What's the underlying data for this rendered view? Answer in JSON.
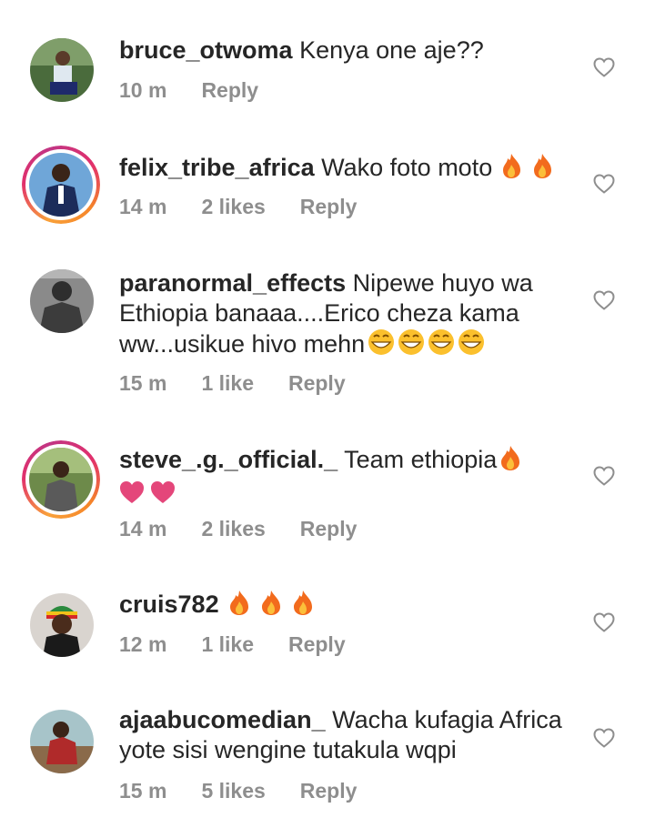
{
  "comments": [
    {
      "username": "bruce_otwoma",
      "text": "Kenya one aje??",
      "time": "10 m",
      "likes": "",
      "reply": "Reply",
      "emoji": ""
    },
    {
      "username": "felix_tribe_africa",
      "text": "Wako foto moto",
      "time": "14 m",
      "likes": "2 likes",
      "reply": "Reply",
      "emoji": "🔥 🔥"
    },
    {
      "username": "paranormal_effects",
      "text": "Nipewe huyo wa Ethiopia banaaa....Erico cheza kama ww...usikue hivo mehn",
      "time": "15 m",
      "likes": "1 like",
      "reply": "Reply",
      "emoji": "😁😁😁😁"
    },
    {
      "username": "steve_.g._official._",
      "text": "Team ethiopia",
      "time": "14 m",
      "likes": "2 likes",
      "reply": "Reply",
      "emoji": "🔥❤❤"
    },
    {
      "username": "cruis782",
      "text": "",
      "time": "12 m",
      "likes": "1 like",
      "reply": "Reply",
      "emoji": "🔥 🔥 🔥"
    },
    {
      "username": "ajaabucomedian_",
      "text": "Wacha kufagia Africa yote sisi wengine tutakula wqpi",
      "time": "15 m",
      "likes": "5 likes",
      "reply": "Reply",
      "emoji": ""
    }
  ],
  "colors": {
    "text": "#262626",
    "meta": "#8e8e8e",
    "heart": "#8e8e8e",
    "fire": "#f26b1d",
    "pink_heart": "#e4467a"
  },
  "icons": {
    "like": "heart-outline-icon",
    "fire": "fire-emoji",
    "grin": "grinning-face-emoji",
    "pink_heart": "pink-heart-emoji"
  }
}
